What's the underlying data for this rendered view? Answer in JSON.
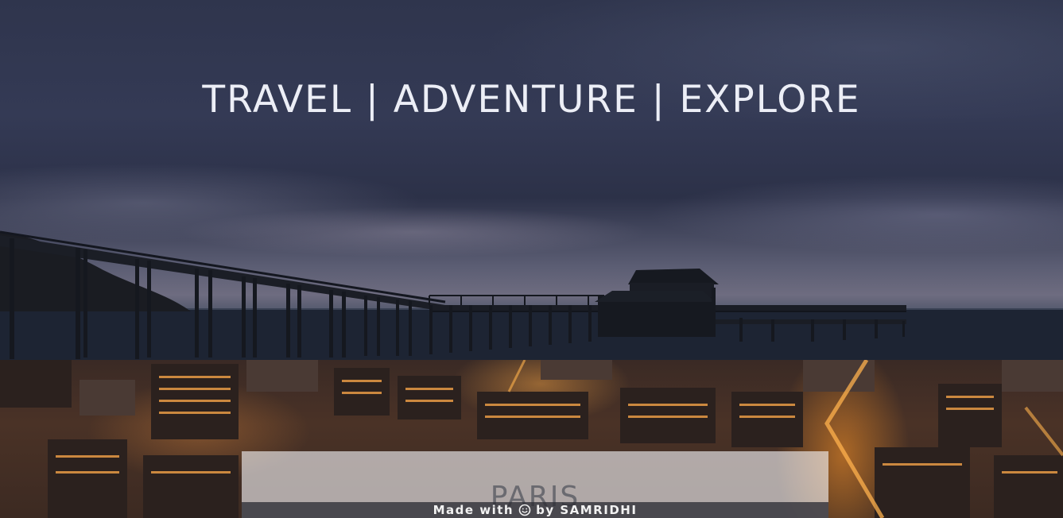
{
  "hero": {
    "title": "TRAVEL | ADVENTURE | EXPLORE"
  },
  "destination_card": {
    "title": "PARIS"
  },
  "footer": {
    "made_with": "Made with",
    "icon": "smile-icon",
    "by": "by SAMRIDHI"
  },
  "colors": {
    "sky": "#2f354d",
    "sea": "#1b2230",
    "city_glow": "#ff9628",
    "title_text": "#eceef6",
    "card_text": "#6a6a70"
  }
}
